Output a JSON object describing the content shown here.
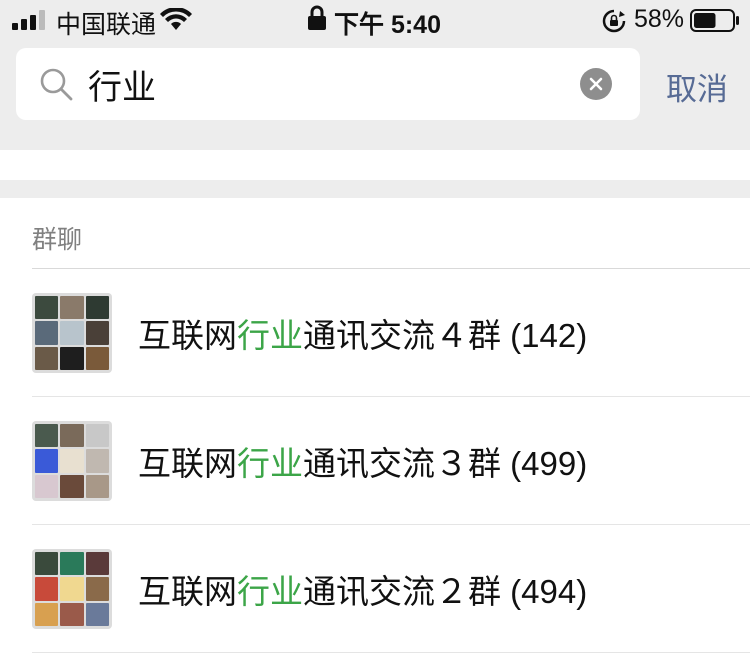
{
  "status_bar": {
    "carrier": "中国联通",
    "time": "下午 5:40",
    "battery_percent": "58%",
    "battery_level": 0.58
  },
  "search": {
    "query": "行业",
    "cancel_label": "取消"
  },
  "results": {
    "section_title": "群聊",
    "groups": [
      {
        "prefix": "互联网",
        "match": "行业",
        "suffix": "通讯交流４群 (142)",
        "avatar_colors": [
          "#3c4a3e",
          "#8a7a6a",
          "#2e3a32",
          "#5a6a7a",
          "#b8c4cc",
          "#4a4038",
          "#6a5a48",
          "#1e1e1e",
          "#7a5a3a"
        ]
      },
      {
        "prefix": "互联网",
        "match": "行业",
        "suffix": "通讯交流３群 (499)",
        "avatar_colors": [
          "#4a5a4e",
          "#7a6a5a",
          "#c8c8c8",
          "#3a5ad8",
          "#e8e0d0",
          "#c0b8b0",
          "#d8c8d0",
          "#6a4a3a",
          "#a89888"
        ]
      },
      {
        "prefix": "互联网",
        "match": "行业",
        "suffix": "通讯交流２群 (494)",
        "avatar_colors": [
          "#3a4a3c",
          "#2a7a5a",
          "#5a3a3a",
          "#c84a3a",
          "#f0d890",
          "#8a6a4a",
          "#d8a050",
          "#9a5a4a",
          "#6a7a9a"
        ]
      }
    ]
  }
}
